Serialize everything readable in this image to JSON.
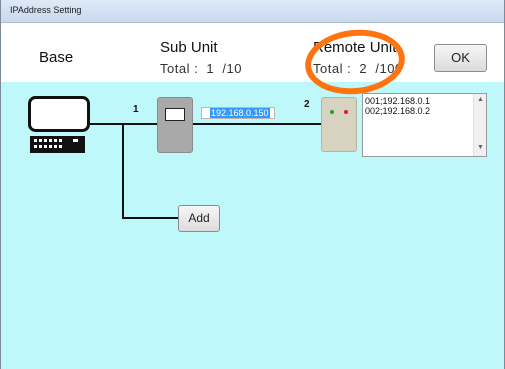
{
  "window": {
    "title": "IPAddress Setting"
  },
  "header": {
    "base_label": "Base",
    "sub_unit": {
      "title": "Sub Unit",
      "total": "Total :  1  /10"
    },
    "remote_unit": {
      "title": "Remote Unit",
      "total": "Total :  2  /100"
    },
    "ok_label": "OK"
  },
  "diagram": {
    "sub_number": "1",
    "sub_ip": "192.168.0.150",
    "remote_number": "2",
    "remote_list": [
      "001;192.168.0.1",
      "002;192.168.0.2"
    ],
    "add_label": "Add"
  },
  "colors": {
    "canvas_bg": "#bff8fa",
    "highlight": "#ff7410",
    "selection": "#3399ff",
    "led_green": "#2a9d2a",
    "led_red": "#d62020"
  },
  "icons": [
    "base-unit-icon",
    "sub-unit-device-icon",
    "remote-unit-device-icon",
    "scroll-up-icon",
    "scroll-down-icon"
  ]
}
